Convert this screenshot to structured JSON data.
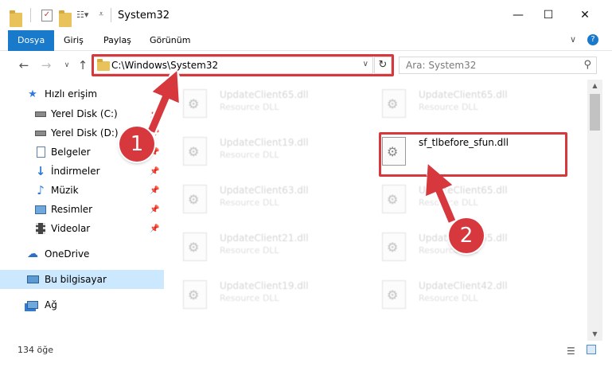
{
  "window": {
    "title": "System32",
    "minimize": "—",
    "maximize": "☐",
    "close": "✕"
  },
  "ribbon": {
    "tabs": [
      "Dosya",
      "Giriş",
      "Paylaş",
      "Görünüm"
    ],
    "collapse": "∨",
    "help": "?"
  },
  "address": {
    "path": "C:\\Windows\\System32",
    "search_placeholder": "Ara: System32"
  },
  "sidebar": {
    "items": [
      {
        "label": "Hızlı erişim",
        "icon": "star-icon"
      },
      {
        "label": "Yerel Disk (C:)",
        "icon": "drive-icon"
      },
      {
        "label": "Yerel Disk (D:)",
        "icon": "drive-icon"
      },
      {
        "label": "Belgeler",
        "icon": "documents-icon"
      },
      {
        "label": "İndirmeler",
        "icon": "download-icon"
      },
      {
        "label": "Müzik",
        "icon": "music-icon"
      },
      {
        "label": "Resimler",
        "icon": "pictures-icon"
      },
      {
        "label": "Videolar",
        "icon": "video-icon"
      },
      {
        "label": "OneDrive",
        "icon": "cloud-icon"
      },
      {
        "label": "Bu bilgisayar",
        "icon": "computer-icon"
      },
      {
        "label": "Ağ",
        "icon": "network-icon"
      }
    ]
  },
  "files": {
    "type_label": "Resource DLL",
    "left": [
      "UpdateClient65.dll",
      "UpdateClient19.dll",
      "UpdateClient63.dll",
      "UpdateClient21.dll",
      "UpdateClient19.dll"
    ],
    "right": [
      "UpdateClient65.dll",
      "sf_tlbefore_sfun.dll",
      "UpdateClient65.dll",
      "UpdateClient65.dll",
      "UpdateClient42.dll"
    ]
  },
  "status": {
    "item_count": "134 öğe"
  },
  "annotations": {
    "step1": "1",
    "step2": "2"
  },
  "colors": {
    "accent": "#1979ca",
    "annotation_red": "#d6383e",
    "selected": "#cce8ff"
  }
}
